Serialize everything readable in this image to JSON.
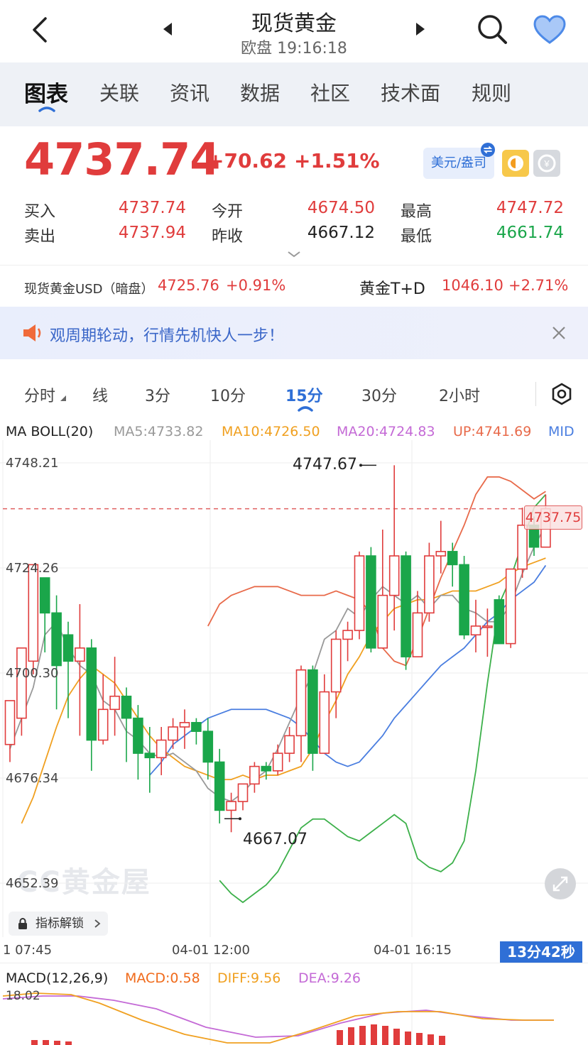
{
  "header": {
    "title": "现货黄金",
    "subtitle": "欧盘 19:16:18"
  },
  "tabs": [
    {
      "label": "图表",
      "active": true
    },
    {
      "label": "关联"
    },
    {
      "label": "资讯"
    },
    {
      "label": "数据"
    },
    {
      "label": "社区"
    },
    {
      "label": "技术面"
    },
    {
      "label": "规则"
    }
  ],
  "quote": {
    "price": "4737.74",
    "change": "+70.62",
    "change_pct": "+1.51%",
    "currency_btn": "美元/盎司",
    "buy_label": "买入",
    "buy": "4737.74",
    "sell_label": "卖出",
    "sell": "4737.94",
    "open_label": "今开",
    "open": "4674.50",
    "prev_label": "昨收",
    "prev": "4667.12",
    "high_label": "最高",
    "high": "4747.72",
    "low_label": "最低",
    "low": "4661.74"
  },
  "ticker": {
    "item1_name": "现货黄金USD（暗盘）",
    "item1_price": "4725.76",
    "item1_chg": "+0.91%",
    "item2_name": "黄金T+D",
    "item2_price": "1046.10",
    "item2_chg": "+2.71%"
  },
  "banner": {
    "text": "观周期轮动，行情先机快人一步！"
  },
  "periods": [
    {
      "label": "分时"
    },
    {
      "label": "线"
    },
    {
      "label": "3分"
    },
    {
      "label": "10分"
    },
    {
      "label": "15分",
      "active": true
    },
    {
      "label": "30分"
    },
    {
      "label": "2小时"
    }
  ],
  "legend": {
    "name": "MA BOLL(20)",
    "ma5": "MA5:4733.82",
    "ma10": "MA10:4726.50",
    "ma20": "MA20:4724.83",
    "up": "UP:4741.69",
    "mid": "MID"
  },
  "chart_labels": {
    "y1": "4748.21",
    "y2": "4724.26",
    "y3": "4700.30",
    "y4": "4676.34",
    "y5": "4652.39",
    "high_mark": "4747.67",
    "low_mark": "4667.07",
    "last_tag": "4737.75",
    "unlock": "指标解锁",
    "watermark": "CC黄金屋"
  },
  "xaxis": {
    "x1": "1 07:45",
    "x2": "04-01 12:00",
    "x3": "04-01 16:15",
    "timer": "13分42秒"
  },
  "macd": {
    "name": "MACD(12,26,9)",
    "macd": "MACD:0.58",
    "diff": "DIFF:9.56",
    "dea": "DEA:9.26",
    "y_top": "18.02"
  },
  "colors": {
    "up": "#e03c3c",
    "down": "#1aa64a",
    "ma5": "#999999",
    "ma10": "#f0a020",
    "ma20": "#c46ad6",
    "boll_up": "#e86a4a",
    "boll_mid": "#4a7ee0",
    "boll_low": "#3cb04a",
    "accent": "#2f6fd6"
  },
  "chart_data": {
    "type": "candlestick",
    "y_range": [
      4652.39,
      4748.21
    ],
    "y_ticks": [
      4748.21,
      4724.26,
      4700.3,
      4676.34,
      4652.39
    ],
    "last_price": 4737.75,
    "candles": [
      [
        4684,
        4694,
        4680,
        4690
      ],
      [
        4690,
        4706,
        4686,
        4703
      ],
      [
        4703,
        4725,
        4700,
        4722
      ],
      [
        4722,
        4714,
        4705,
        4718
      ],
      [
        4714,
        4702,
        4692,
        4718
      ],
      [
        4709,
        4703,
        4690,
        4712
      ],
      [
        4703,
        4706,
        4686,
        4716
      ],
      [
        4706,
        4685,
        4678,
        4708
      ],
      [
        4685,
        4692,
        4684,
        4700
      ],
      [
        4692,
        4695,
        4686,
        4704
      ],
      [
        4695,
        4690,
        4680,
        4697
      ],
      [
        4690,
        4682,
        4676,
        4693
      ],
      [
        4682,
        4681,
        4673,
        4688
      ],
      [
        4681,
        4685,
        4677,
        4688
      ],
      [
        4685,
        4688,
        4683,
        4690
      ],
      [
        4688,
        4689,
        4683,
        4692
      ],
      [
        4689,
        4687,
        4684,
        4690
      ],
      [
        4687,
        4680,
        4676,
        4690
      ],
      [
        4680,
        4669,
        4666,
        4683
      ],
      [
        4669,
        4671,
        4664,
        4673
      ],
      [
        4671,
        4675,
        4669,
        4675
      ],
      [
        4675,
        4679,
        4673,
        4680
      ],
      [
        4679,
        4678,
        4676,
        4680
      ],
      [
        4678,
        4682,
        4677,
        4684
      ],
      [
        4682,
        4686,
        4680,
        4688
      ],
      [
        4686,
        4701,
        4680,
        4702
      ],
      [
        4701,
        4682,
        4678,
        4702
      ],
      [
        4682,
        4696,
        4682,
        4700
      ],
      [
        4696,
        4708,
        4690,
        4710
      ],
      [
        4708,
        4710,
        4703,
        4712
      ],
      [
        4710,
        4727,
        4708,
        4728
      ],
      [
        4727,
        4706,
        4705,
        4729
      ],
      [
        4706,
        4718,
        4712,
        4733
      ],
      [
        4718,
        4727,
        4710,
        4747.67
      ],
      [
        4727,
        4704,
        4701,
        4728
      ],
      [
        4704,
        4714,
        4704,
        4719
      ],
      [
        4714,
        4727,
        4712,
        4730
      ],
      [
        4727,
        4728,
        4723,
        4735
      ],
      [
        4728,
        4725,
        4720,
        4730
      ],
      [
        4725,
        4709,
        4708,
        4727
      ],
      [
        4709,
        4711,
        4705,
        4717
      ],
      [
        4711,
        4711,
        4704,
        4715
      ],
      [
        4717,
        4707,
        4709,
        4718
      ],
      [
        4707,
        4724,
        4706,
        4724
      ],
      [
        4724,
        4734,
        4722,
        4738
      ],
      [
        4734,
        4729,
        4727,
        4736
      ],
      [
        4729,
        4737.75,
        4732,
        4741
      ]
    ],
    "ma5": [
      4683,
      4690,
      4697,
      4709,
      4712,
      4706,
      4702,
      4700,
      4694,
      4692,
      4687,
      4685,
      4682,
      4681,
      4682,
      4680,
      4678,
      4674,
      4672,
      4671,
      4673,
      4676,
      4678,
      4683,
      4689,
      4695,
      4700,
      4708,
      4710,
      4715,
      4713,
      4717,
      4720,
      4718,
      4716,
      4718,
      4715,
      4718,
      4718,
      4715,
      4714,
      4712,
      4712,
      4716,
      4723,
      4729,
      4734
    ],
    "ma10": [
      4666,
      4672,
      4680,
      4688,
      4695,
      4699,
      4702,
      4700,
      4698,
      4694,
      4690,
      4686,
      4683,
      4681,
      4679,
      4678,
      4677,
      4676,
      4676,
      4677,
      4676,
      4677,
      4677,
      4678,
      4679,
      4683,
      4689,
      4694,
      4700,
      4704,
      4709,
      4712,
      4715,
      4716,
      4717,
      4717,
      4718,
      4719,
      4719,
      4719,
      4720,
      4721,
      4723,
      4724.5,
      4725.5,
      4726.5
    ],
    "boll_up": [
      4711,
      4716,
      4718,
      4719,
      4720,
      4720,
      4720,
      4719,
      4718,
      4718,
      4718,
      4719,
      4718,
      4717,
      4714,
      4706,
      4703,
      4702,
      4708,
      4715,
      4722,
      4728,
      4734,
      4741,
      4745,
      4745,
      4744,
      4742,
      4740,
      4741.69
    ],
    "boll_mid": [
      4677,
      4680,
      4684,
      4686,
      4688,
      4690,
      4691,
      4692,
      4692,
      4692,
      4692,
      4691,
      4690,
      4688,
      4685,
      4682,
      4680,
      4679,
      4680,
      4683,
      4686,
      4690,
      4693,
      4696,
      4699,
      4702,
      4704,
      4706,
      4709,
      4712,
      4714,
      4717,
      4719,
      4721,
      4724.83
    ],
    "boll_low": [
      4653,
      4650,
      4648,
      4650,
      4652,
      4655,
      4660,
      4665,
      4667,
      4667,
      4665,
      4663,
      4662,
      4664,
      4666,
      4668,
      4666,
      4658,
      4656,
      4655,
      4657,
      4662,
      4678,
      4698,
      4716,
      4722,
      4730,
      4738,
      4741
    ]
  }
}
